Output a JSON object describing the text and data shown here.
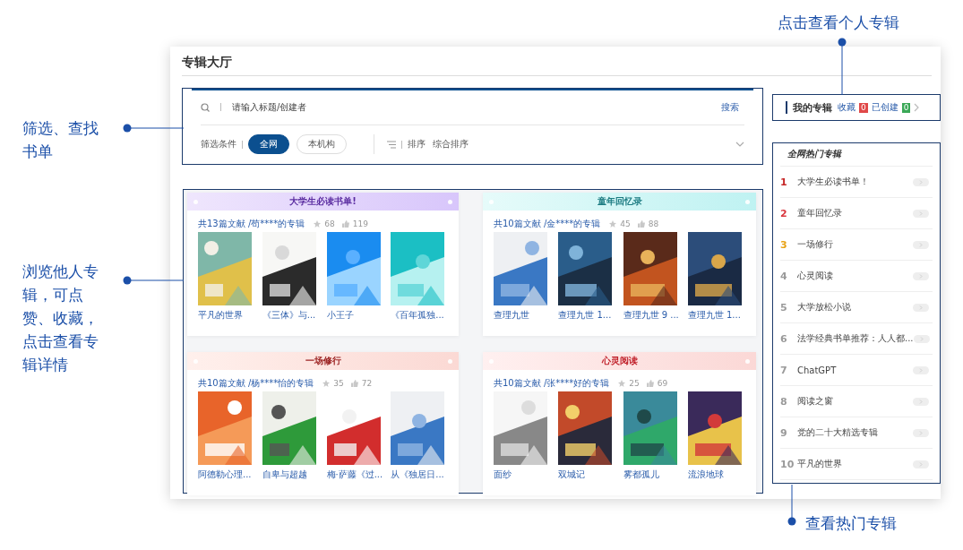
{
  "window": {
    "title": "专辑大厅"
  },
  "search": {
    "placeholder": "请输入标题/创建者",
    "button": "搜索"
  },
  "filters": {
    "label": "筛选条件",
    "options": [
      {
        "label": "全网",
        "selected": true
      },
      {
        "label": "本机构",
        "selected": false
      }
    ],
    "sort_label": "排序",
    "sort_value": "综合排序"
  },
  "albums": [
    {
      "title": "大学生必读书单!",
      "kind": "purple",
      "info": "共13篇文献 /苟****的专辑",
      "favorites": "68",
      "likes": "119",
      "books": [
        "平凡的世界",
        "《三体》与...",
        "小王子",
        "《百年孤独..."
      ]
    },
    {
      "title": "童年回忆录",
      "kind": "cyan",
      "info": "共10篇文献 /金****的专辑",
      "favorites": "45",
      "likes": "88",
      "books": [
        "查理九世",
        "查理九世 1...",
        "查理九世 9 ...",
        "查理九世 1..."
      ]
    },
    {
      "title": "一场修行",
      "kind": "pink",
      "info": "共10篇文献 /杨****怡的专辑",
      "favorites": "35",
      "likes": "72",
      "books": [
        "阿德勒心理...",
        "自卑与超越",
        "梅·萨藤《过...",
        "从《独居日..."
      ]
    },
    {
      "title": "心灵阅读",
      "kind": "rose",
      "info": "共10篇文献 /张****好的专辑",
      "favorites": "25",
      "likes": "69",
      "books": [
        "面纱",
        "双城记",
        "雾都孤儿",
        "流浪地球"
      ]
    }
  ],
  "my_albums": {
    "title": "我的专辑",
    "collected_label": "收藏",
    "collected": "0",
    "created_label": "已创建",
    "created": "0"
  },
  "hot_albums": {
    "title": "全网热门专辑",
    "items": [
      {
        "rank": "1",
        "title": "大学生必读书单！",
        "color": "#c62828"
      },
      {
        "rank": "2",
        "title": "童年回忆录",
        "color": "#d9363e"
      },
      {
        "rank": "3",
        "title": "一场修行",
        "color": "#e8a317"
      },
      {
        "rank": "4",
        "title": "心灵阅读",
        "color": "#9a9a9a"
      },
      {
        "rank": "5",
        "title": "大学放松小说",
        "color": "#9a9a9a"
      },
      {
        "rank": "6",
        "title": "法学经典书单推荐：人人都...",
        "color": "#9a9a9a"
      },
      {
        "rank": "7",
        "title": "ChatGPT",
        "color": "#9a9a9a"
      },
      {
        "rank": "8",
        "title": "阅读之窗",
        "color": "#9a9a9a"
      },
      {
        "rank": "9",
        "title": "党的二十大精选专辑",
        "color": "#9a9a9a"
      },
      {
        "rank": "10",
        "title": "平凡的世界",
        "color": "#9a9a9a"
      }
    ]
  },
  "annotations": [
    {
      "text": "点击查看个人专辑",
      "kind": "my_albums"
    },
    {
      "text": "筛选、查找书单",
      "kind": "filter"
    },
    {
      "text": "浏览他人专辑，可点赞、收藏，点击查看专辑详情",
      "kind": "albums"
    },
    {
      "text": "查看热门专辑",
      "kind": "hot_albums"
    }
  ]
}
